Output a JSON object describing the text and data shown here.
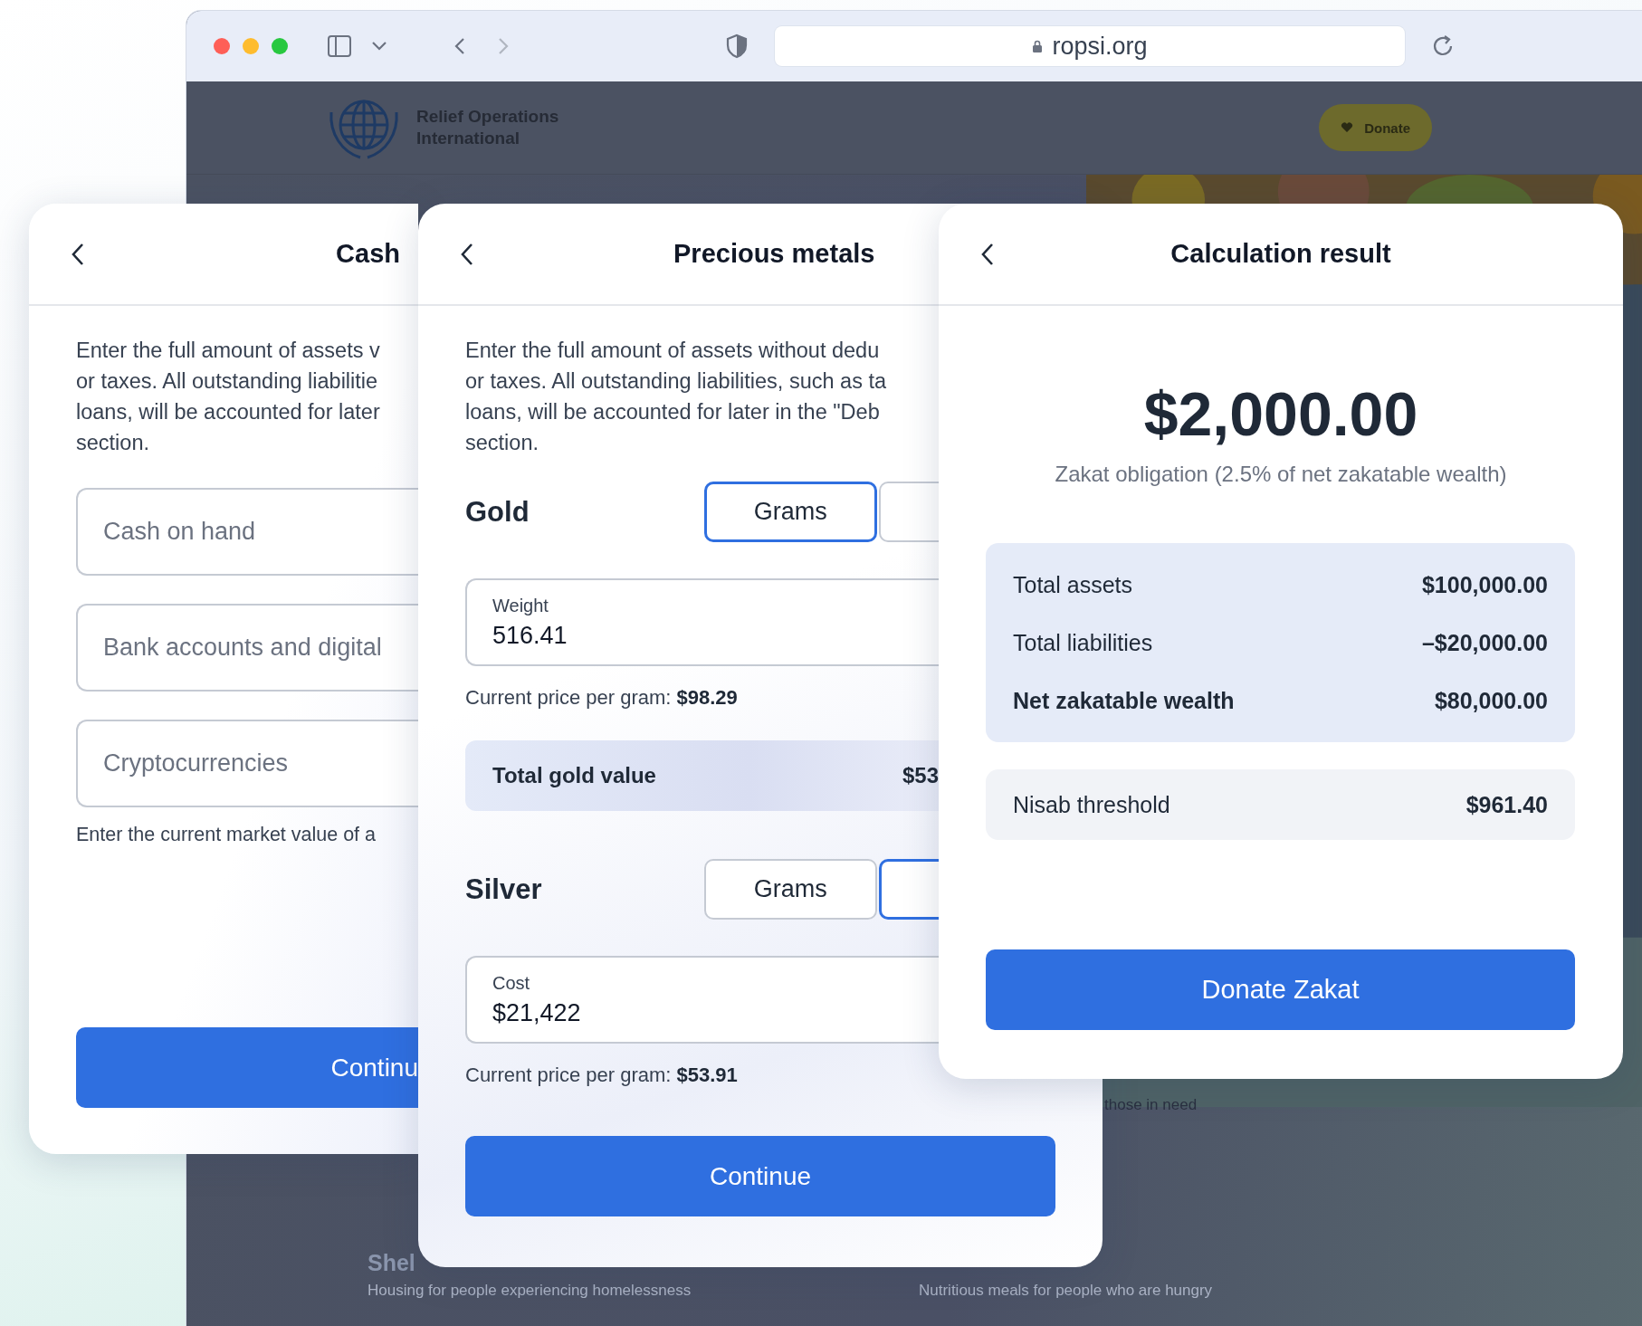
{
  "browser": {
    "url": "ropsi.org"
  },
  "site": {
    "org_name_lines": [
      "Relief Operations",
      "International"
    ],
    "donate_button": "Donate",
    "fragment": "those in need",
    "programs": [
      {
        "title": "Shel",
        "description": "Housing for people experiencing homelessness"
      },
      {
        "description": "Nutritious meals for people who are hungry"
      }
    ]
  },
  "cash_card": {
    "title": "Cash",
    "description_lines": [
      "Enter the full amount of assets v",
      "or taxes. All outstanding liabilitie",
      "loans, will be accounted for later",
      "section."
    ],
    "fields": [
      {
        "placeholder": "Cash on hand"
      },
      {
        "placeholder": "Bank accounts and digital"
      },
      {
        "placeholder": "Cryptocurrencies"
      }
    ],
    "hint": "Enter the current market value of a",
    "button": "Continu"
  },
  "metals_card": {
    "title": "Precious metals",
    "description_lines": [
      "Enter the full amount of assets without dedu",
      "or taxes. All outstanding liabilities, such as ta",
      "loans, will be accounted for later in the \"Deb",
      "section."
    ],
    "metals": [
      {
        "name": "Gold",
        "units": [
          {
            "label": "Grams",
            "selected": true
          },
          {
            "selected": false
          }
        ],
        "field": {
          "label": "Weight",
          "value": "516.41"
        },
        "price": "Current price per gram: **$98.29**",
        "total": {
          "label": "Total gold value",
          "value": "$53"
        }
      },
      {
        "name": "Silver",
        "units": [
          {
            "label": "Grams",
            "selected": false
          },
          {
            "selected": true
          }
        ],
        "field": {
          "label": "Cost",
          "value": "$21,422"
        },
        "price": "Current price per gram: **$53.91**"
      }
    ],
    "button": "Continue"
  },
  "result_card": {
    "title": "Calculation result",
    "amount": "$2,000.00",
    "caption": "Zakat obligation (2.5% of net zakatable wealth)",
    "summary": [
      {
        "label": "Total assets",
        "value": "$100,000.00",
        "kind": "normal"
      },
      {
        "label": "Total liabilities",
        "value": "–$20,000.00",
        "kind": "normal"
      },
      {
        "label": "Net zakatable wealth",
        "value": "$80,000.00",
        "kind": "total"
      }
    ],
    "nisab": {
      "label": "Nisab threshold",
      "value": "$961.40"
    },
    "button": "Donate Zakat"
  }
}
